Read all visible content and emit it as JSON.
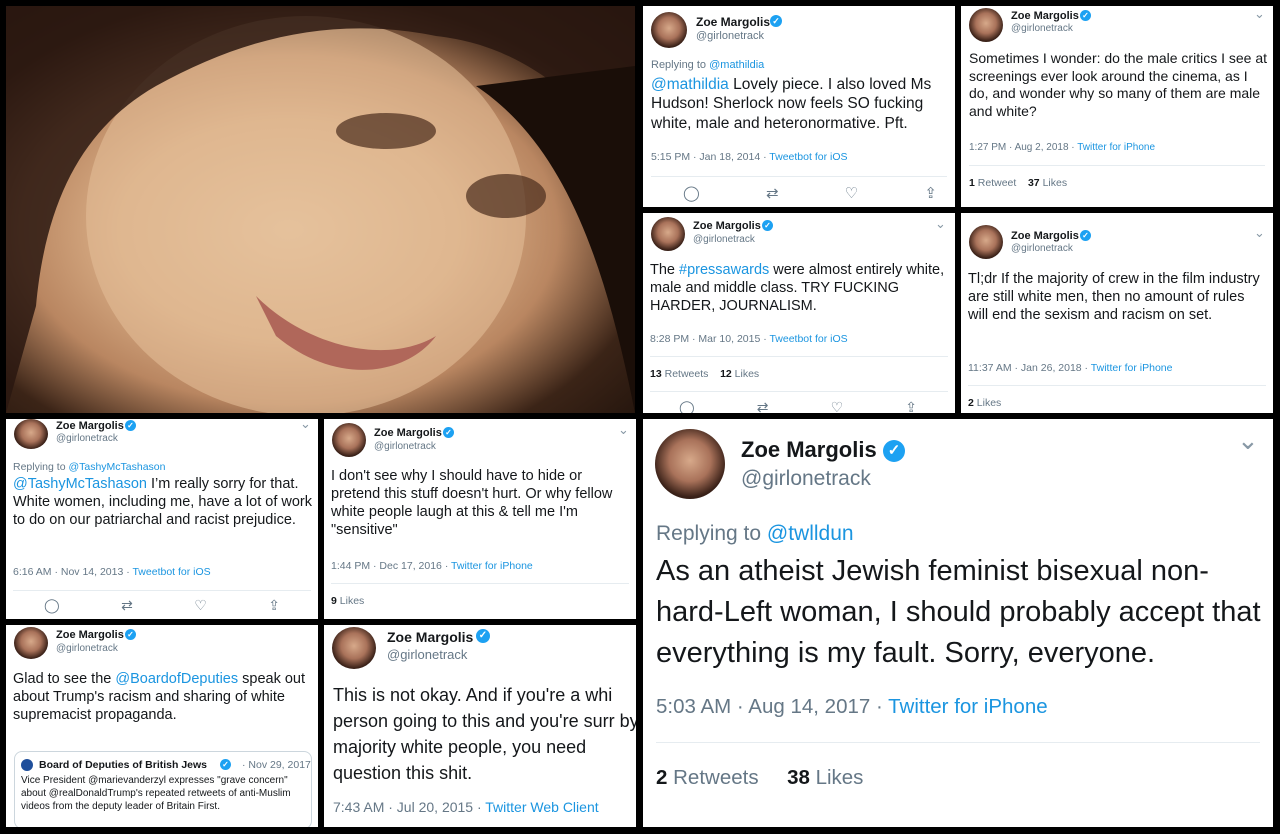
{
  "profile": {
    "name": "Zoe Margolis",
    "handle": "@girlonetrack",
    "verified_glyph": "✓"
  },
  "action_icons": [
    "reply-icon",
    "retweet-icon",
    "like-icon",
    "share-icon"
  ],
  "icons": {
    "reply": "◯",
    "retweet": "⇄",
    "like": "♡",
    "share": "⇪",
    "chevron": "⌄"
  },
  "tweets": {
    "t1": {
      "reply_prefix": "Replying to",
      "reply_to": "@mathildia",
      "mention": "@mathildia",
      "text": " Lovely piece. I also loved Ms Hudson! Sherlock now feels SO fucking white, male and heteronormative. Pft.",
      "time": "5:15 PM · Jan 18, 2014 · ",
      "client": "Tweetbot for iOS"
    },
    "t2": {
      "text": "Sometimes I wonder: do the male critics I see at screenings ever look around the cinema, as I do, and wonder why so many of them are male and white?",
      "time": "1:27 PM · Aug 2, 2018 · ",
      "client": "Twitter for iPhone",
      "retweets": "1",
      "retweets_label": "Retweet",
      "likes": "37",
      "likes_label": "Likes"
    },
    "t3": {
      "pre": "The ",
      "hashtag": "#pressawards",
      "text": " were almost entirely white, male and middle class. TRY FUCKING HARDER, JOURNALISM.",
      "time": "8:28 PM · Mar 10, 2015 · ",
      "client": "Tweetbot for iOS",
      "retweets": "13",
      "retweets_label": "Retweets",
      "likes": "12",
      "likes_label": "Likes"
    },
    "t4": {
      "text": "Tl;dr If the majority of crew in the film industry are still white men, then no amount of rules will end the sexism and racism on set.",
      "time": "11:37 AM · Jan 26, 2018 · ",
      "client": "Twitter for iPhone",
      "likes": "2",
      "likes_label": "Likes"
    },
    "t5": {
      "reply_prefix": "Replying to",
      "reply_to": "@TashyMcTashason",
      "mention": "@TashyMcTashason",
      "text": " I’m really sorry for that. White women, including me, have a lot of work to do on our patriarchal and racist prejudice.",
      "time": "6:16 AM · Nov 14, 2013 · ",
      "client": "Tweetbot for iOS"
    },
    "t6": {
      "text": "I don't see why I should have to hide or pretend this stuff doesn't hurt. Or why fellow white people laugh at this & tell me I'm \"sensitive\"",
      "time": "1:44 PM · Dec 17, 2016 · ",
      "client": "Twitter for iPhone",
      "likes": "9",
      "likes_label": "Likes"
    },
    "t7": {
      "reply_prefix": "Replying to",
      "reply_to": "@twlldun",
      "text": "As an atheist Jewish feminist bisexual non-hard-Left woman, I should probably accept that everything is my fault. Sorry, everyone.",
      "time": "5:03 AM · Aug 14, 2017 · ",
      "client": "Twitter for iPhone",
      "retweets": "2",
      "retweets_label": "Retweets",
      "likes": "38",
      "likes_label": "Likes"
    },
    "t8": {
      "pre": "Glad to see the ",
      "mention": "@BoardofDeputies",
      "text": " speak out about Trump's racism and sharing of white supremacist propaganda.",
      "quote": {
        "name": "Board of Deputies of British Jews",
        "date": "· Nov 29, 2017",
        "text": "Vice President @marievanderzyl expresses \"grave concern\" about @realDonaldTrump's repeated retweets of anti-Muslim videos from the deputy leader of Britain First."
      }
    },
    "t9": {
      "text": "This is not okay. And if you're a whi person going to this and you're surr by majority white people, you need question this shit.",
      "time": "7:43 AM · Jul 20, 2015 · ",
      "client": "Twitter Web Client"
    }
  }
}
